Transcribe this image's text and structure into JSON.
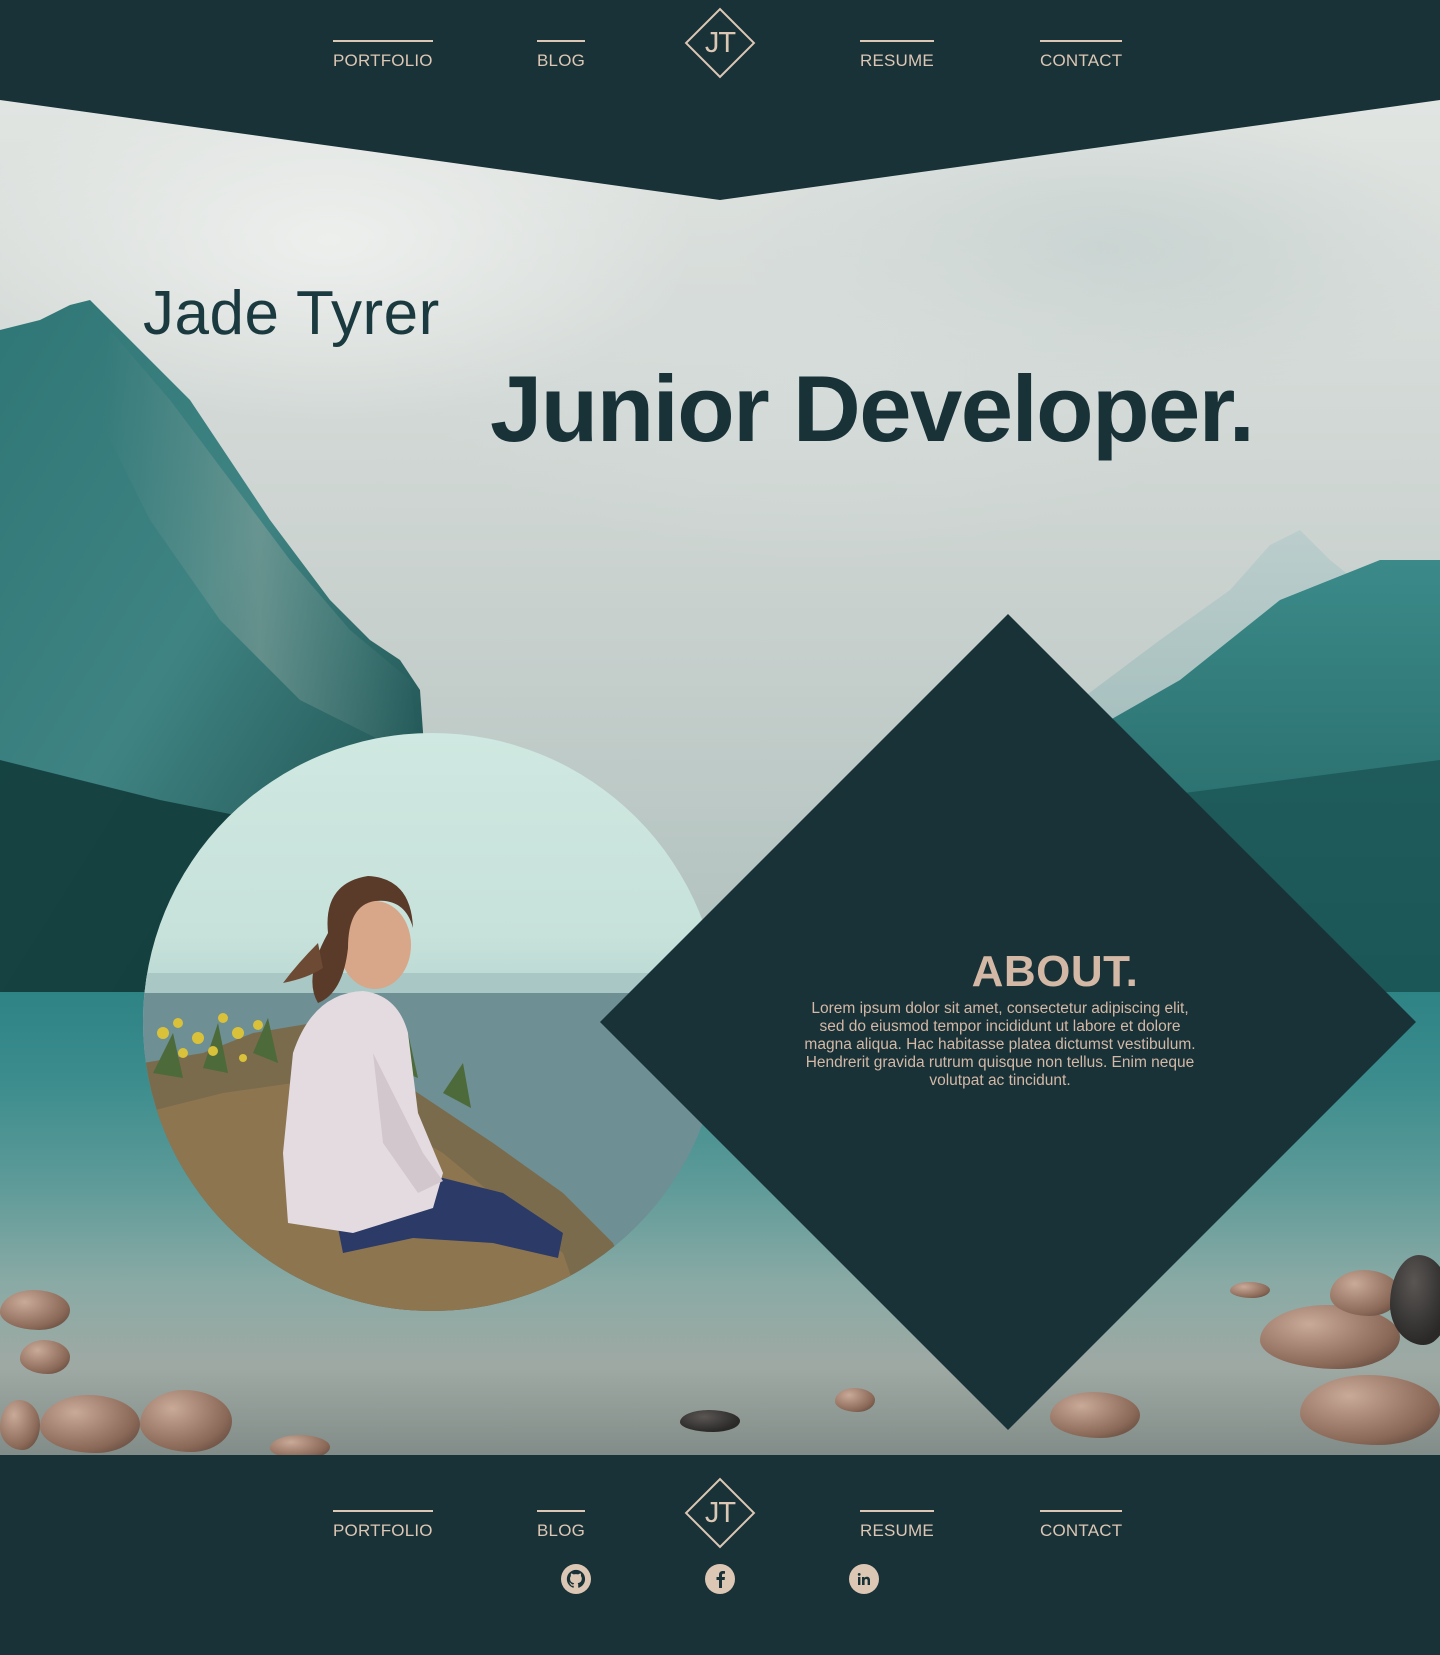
{
  "nav": {
    "items": [
      {
        "label": "PORTFOLIO"
      },
      {
        "label": "BLOG"
      },
      {
        "label": "RESUME"
      },
      {
        "label": "CONTACT"
      }
    ],
    "logo_text": "JT"
  },
  "hero": {
    "name": "Jade Tyrer",
    "headline": "Junior Developer."
  },
  "about": {
    "title": "ABOUT.",
    "body": "Lorem ipsum dolor sit amet, consectetur adipiscing elit, sed do eiusmod tempor incididunt ut labore et dolore magna aliqua. Hac habitasse platea dictumst vestibulum. Hendrerit gravida rutrum quisque non tellus. Enim neque volutpat ac tincidunt."
  },
  "footer": {
    "nav": [
      {
        "label": "PORTFOLIO"
      },
      {
        "label": "BLOG"
      },
      {
        "label": "RESUME"
      },
      {
        "label": "CONTACT"
      }
    ],
    "logo_text": "JT",
    "social": [
      {
        "icon": "github-icon"
      },
      {
        "icon": "facebook-icon"
      },
      {
        "icon": "linkedin-icon"
      }
    ]
  },
  "colors": {
    "primary_dark": "#183238",
    "accent_tan": "#dcc6b4",
    "about_text": "#d4b8a6"
  }
}
